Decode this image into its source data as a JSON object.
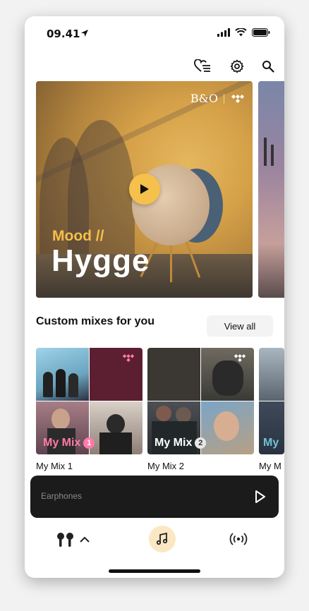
{
  "status_bar": {
    "time": "09.41"
  },
  "hero": {
    "eyebrow": "Mood //",
    "title": "Hygge",
    "brand_logo": "B&O"
  },
  "section": {
    "heading": "Custom mixes for you",
    "view_all_label": "View all"
  },
  "mixes": [
    {
      "overlay_label": "My Mix",
      "number": "1",
      "title": "My Mix 1",
      "accent": "#ff7aa8"
    },
    {
      "overlay_label": "My Mix",
      "number": "2",
      "title": "My Mix 2",
      "accent": "#ffffff"
    },
    {
      "overlay_label": "My",
      "title": "My M"
    }
  ],
  "player": {
    "device_name": "Earphones"
  },
  "icons": {
    "favorites": "heart-list-icon",
    "settings": "gear-icon",
    "search": "search-icon",
    "play": "play-icon",
    "earphones": "earphones-icon",
    "music": "music-note-icon",
    "broadcast": "broadcast-icon"
  },
  "colors": {
    "accent_yellow": "#f5c04b",
    "player_bg": "#1b1b1b",
    "music_tab_bg": "#fbe7c2"
  }
}
